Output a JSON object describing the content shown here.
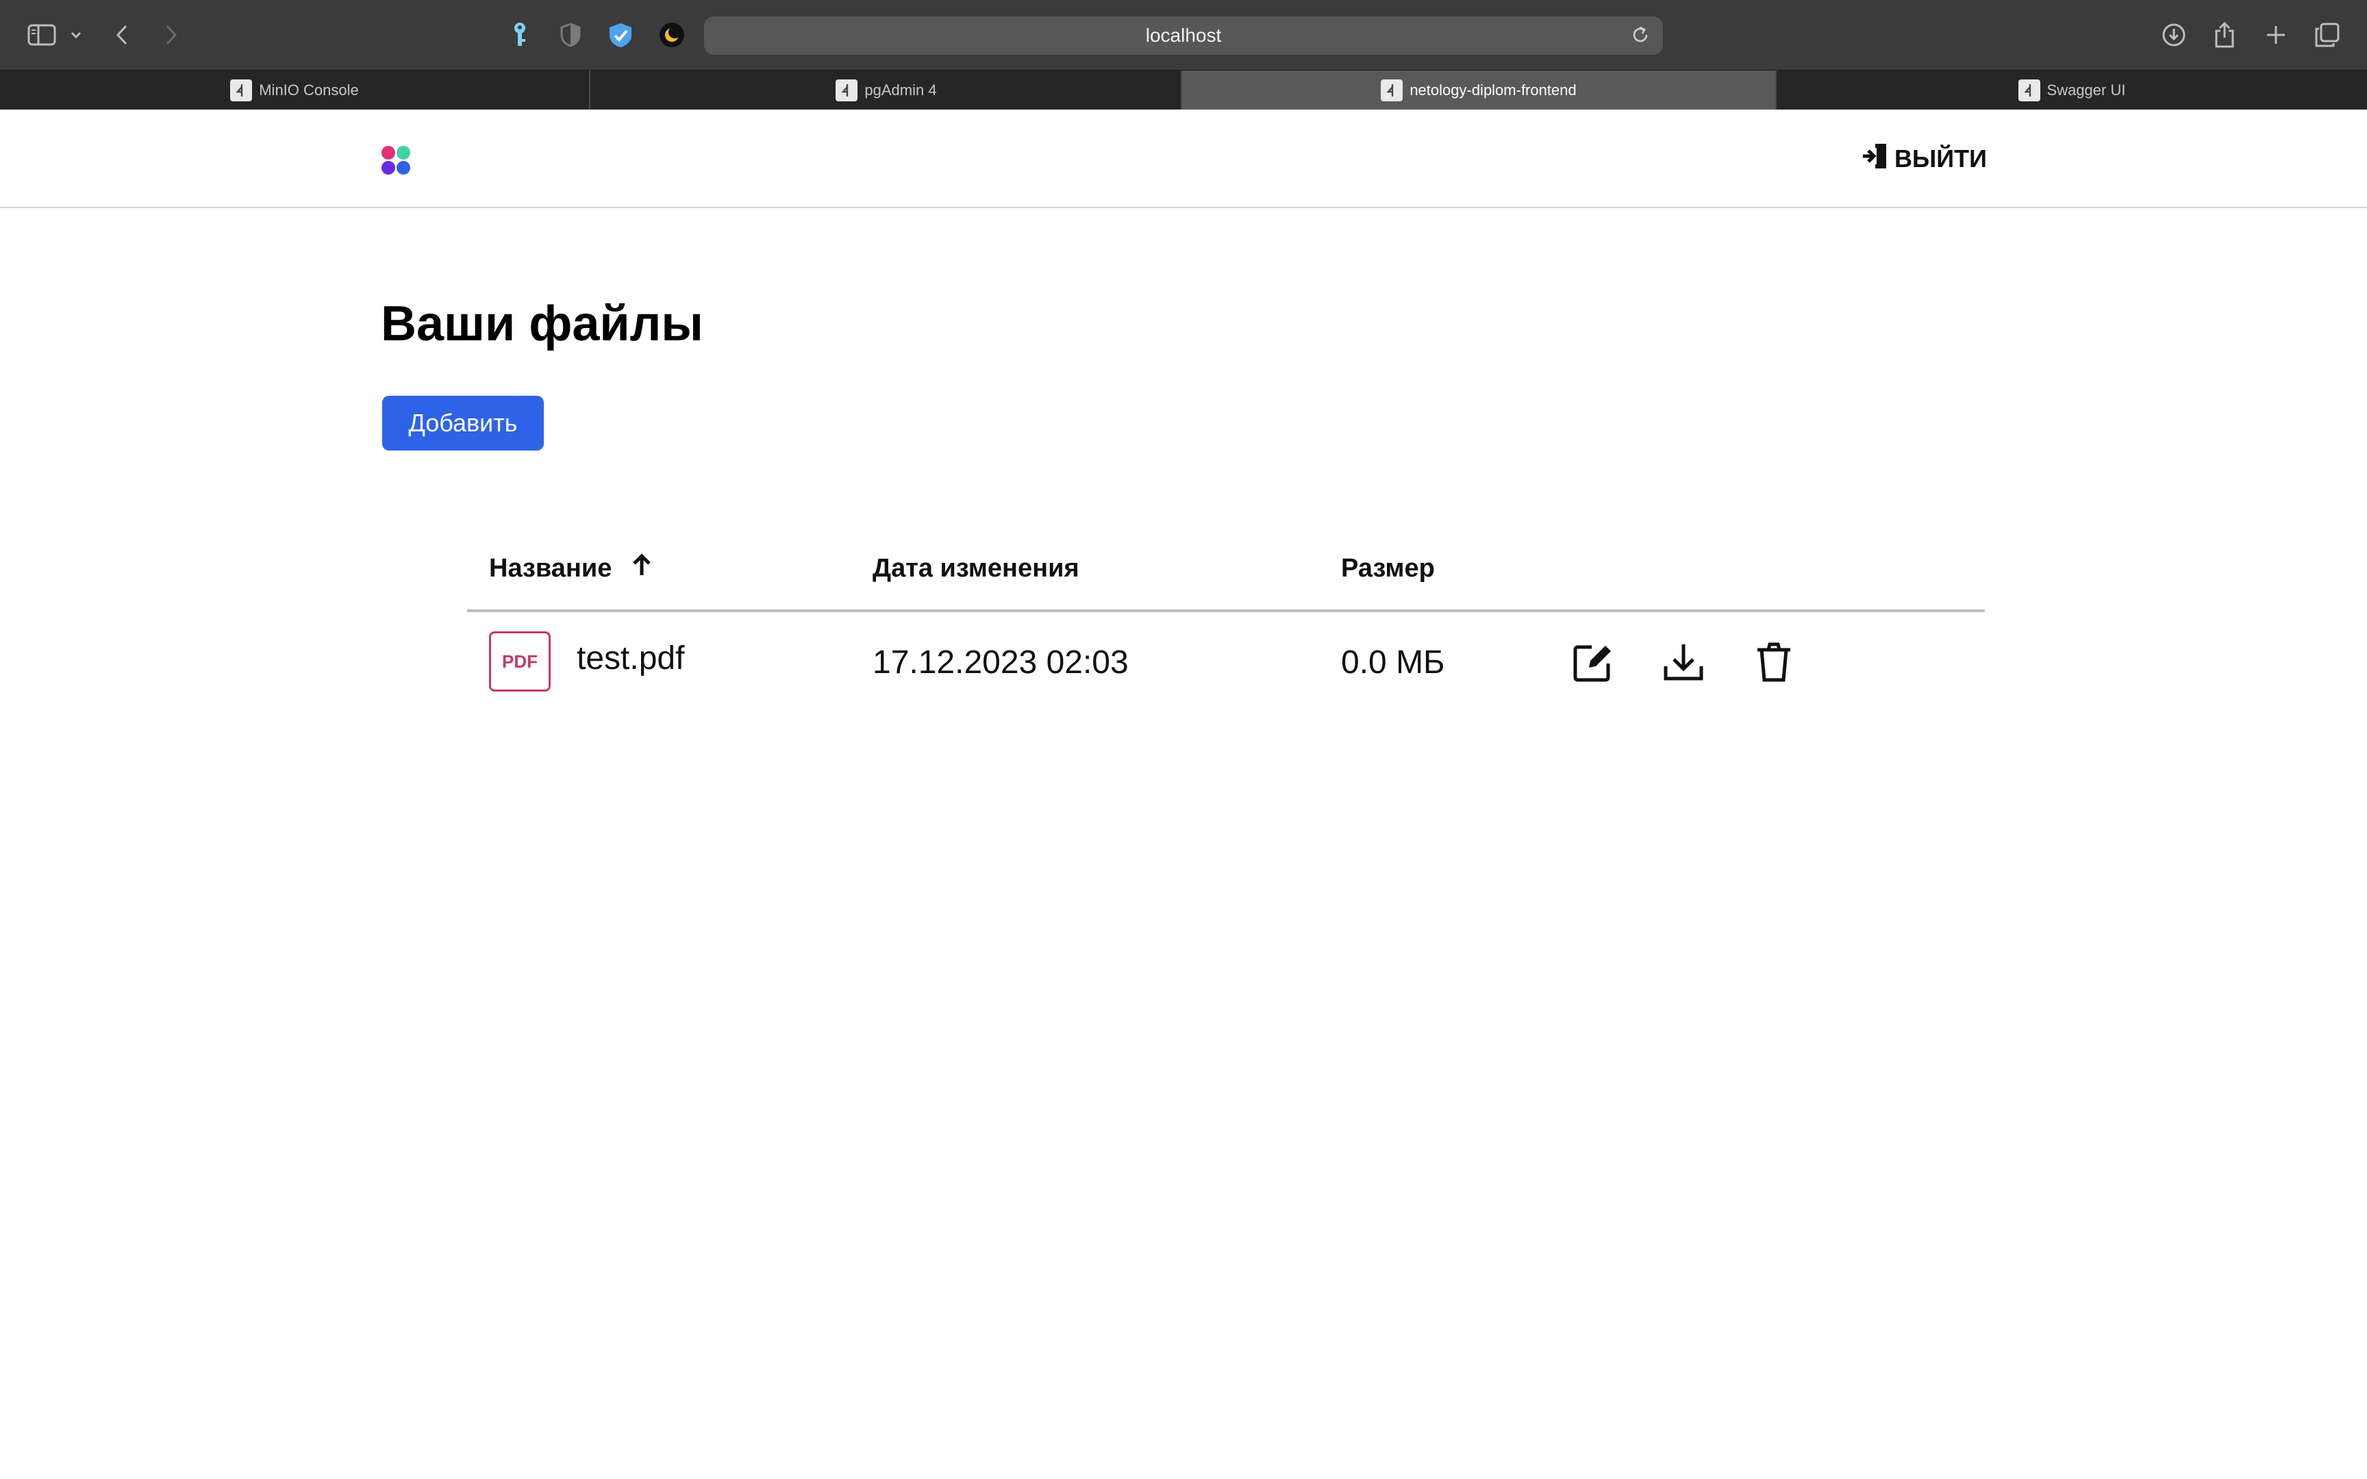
{
  "browser": {
    "url": "localhost",
    "tabs": [
      {
        "label": "MinIO Console",
        "active": false
      },
      {
        "label": "pgAdmin 4",
        "active": false
      },
      {
        "label": "netology-diplom-frontend",
        "active": true
      },
      {
        "label": "Swagger UI",
        "active": false
      }
    ]
  },
  "header": {
    "logo_icon": "app-logo-icon",
    "logout_label": "ВЫЙТИ"
  },
  "main": {
    "title": "Ваши файлы",
    "add_label": "Добавить"
  },
  "table": {
    "columns": {
      "name": "Название",
      "date": "Дата изменения",
      "size": "Размер"
    },
    "sort_indicator": "sort-arrow-up-icon",
    "rows": [
      {
        "type_badge": "PDF",
        "name": "test.pdf",
        "modified": "17.12.2023 02:03",
        "size": "0.0 МБ"
      }
    ]
  },
  "colors": {
    "accent": "#2e63e8",
    "pdf_badge": "#c43a6a",
    "chrome_toolbar": "#3b3b3b",
    "chrome_tabbar": "#262626"
  }
}
